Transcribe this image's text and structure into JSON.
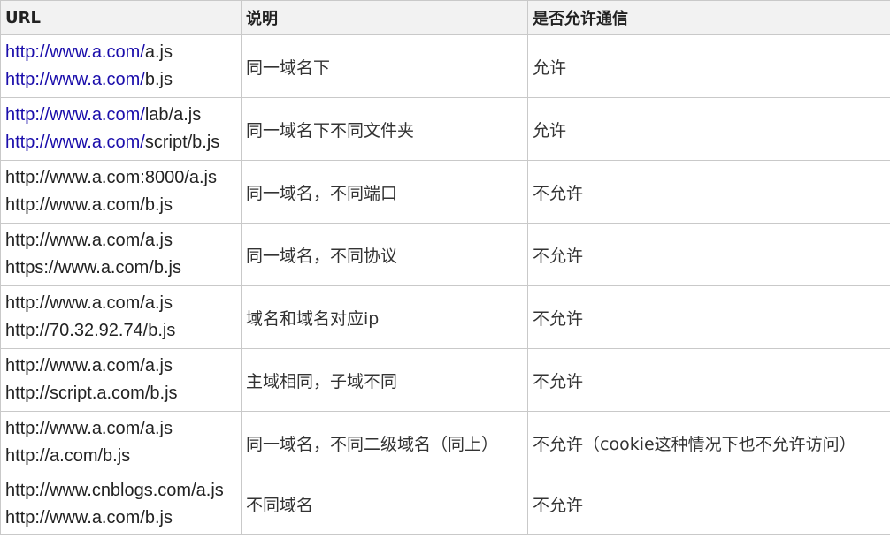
{
  "table": {
    "headers": {
      "url": "URL",
      "description": "说明",
      "allowed": "是否允许通信"
    },
    "rows": [
      {
        "urls": [
          {
            "host": "http://www.a.com/",
            "path": "a.js",
            "link": true
          },
          {
            "host": "http://www.a.com/",
            "path": "b.js",
            "link": true
          }
        ],
        "description": "同一域名下",
        "allowed": "允许"
      },
      {
        "urls": [
          {
            "host": "http://www.a.com/",
            "path": "lab/a.js",
            "link": true
          },
          {
            "host": "http://www.a.com/",
            "path": "script/b.js",
            "link": true
          }
        ],
        "description": "同一域名下不同文件夹",
        "allowed": "允许"
      },
      {
        "urls": [
          {
            "host": "http://www.a.com:8000/a.js",
            "path": "",
            "link": false
          },
          {
            "host": "http://www.a.com/b.js",
            "path": "",
            "link": false
          }
        ],
        "description": "同一域名，不同端口",
        "allowed": "不允许"
      },
      {
        "urls": [
          {
            "host": "http://www.a.com/a.js",
            "path": "",
            "link": false
          },
          {
            "host": "https://www.a.com/b.js",
            "path": "",
            "link": false
          }
        ],
        "description": "同一域名，不同协议",
        "allowed": "不允许"
      },
      {
        "urls": [
          {
            "host": "http://www.a.com/a.js",
            "path": "",
            "link": false
          },
          {
            "host": "http://70.32.92.74/b.js",
            "path": "",
            "link": false
          }
        ],
        "description": "域名和域名对应ip",
        "allowed": "不允许"
      },
      {
        "urls": [
          {
            "host": "http://www.a.com/a.js",
            "path": "",
            "link": false
          },
          {
            "host": "http://script.a.com/b.js",
            "path": "",
            "link": false
          }
        ],
        "description": "主域相同，子域不同",
        "allowed": "不允许"
      },
      {
        "urls": [
          {
            "host": "http://www.a.com/a.js",
            "path": "",
            "link": false
          },
          {
            "host": "http://a.com/b.js",
            "path": "",
            "link": false
          }
        ],
        "description": "同一域名，不同二级域名（同上）",
        "allowed": "不允许（cookie这种情况下也不允许访问）"
      },
      {
        "urls": [
          {
            "host": "http://www.cnblogs.com/a.js",
            "path": "",
            "link": false
          },
          {
            "host": "http://www.a.com/b.js",
            "path": "",
            "link": false
          }
        ],
        "description": "不同域名",
        "allowed": "不允许"
      }
    ]
  },
  "colors": {
    "link": "#1a0dab",
    "header_bg": "#f2f2f2",
    "border": "#c9c9c9",
    "text": "#222222"
  }
}
